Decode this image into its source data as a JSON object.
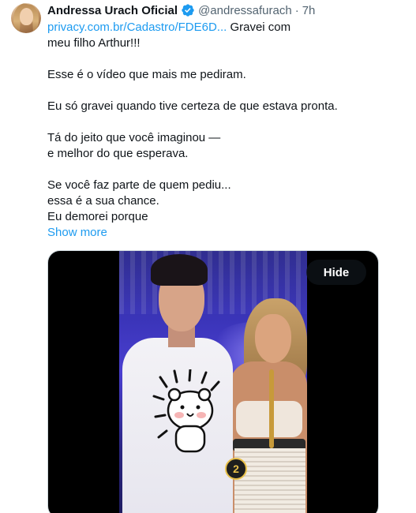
{
  "author": {
    "display_name": "Andressa Urach Oficial",
    "handle": "@andressafurach",
    "separator": "·",
    "time": "7h"
  },
  "tweet": {
    "link_text": "privacy.com.br/Cadastro/FDE6D...",
    "line1_rest": " Gravei com",
    "line2": "meu filho Arthur!!!",
    "para2": "Esse é o vídeo que mais me pediram.",
    "para3": "Eu só gravei quando tive certeza de que estava pronta.",
    "para4_l1": "Tá do jeito que você imaginou —",
    "para4_l2": "e melhor do que esperava.",
    "para5_l1": "Se você faz parte de quem pediu...",
    "para5_l2": "essa é a sua chance.",
    "para5_l3": "Eu demorei porque",
    "show_more": "Show more"
  },
  "media": {
    "hide_label": "Hide",
    "badge_number": "2"
  },
  "colors": {
    "link": "#1d9bf0",
    "text": "#0f1419",
    "secondary": "#536471",
    "verified": "#1d9bf0"
  }
}
